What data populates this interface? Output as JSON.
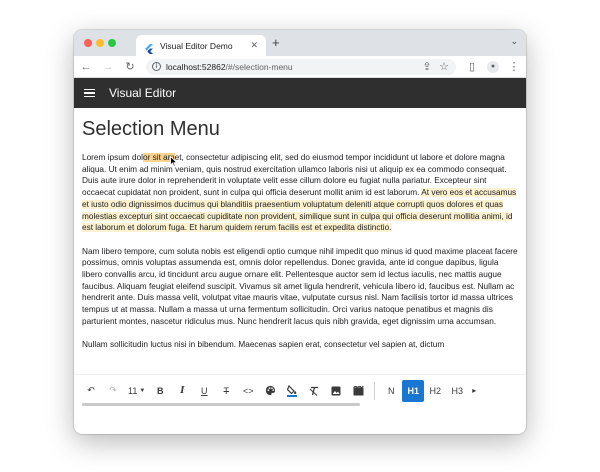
{
  "browser": {
    "tab_title": "Visual Editor Demo",
    "tab_close": "✕",
    "new_tab": "+",
    "tab_menu": "⌄",
    "url_host": "localhost:52862",
    "url_path": "/#/selection-menu",
    "icons": [
      "back-icon",
      "forward-icon",
      "reload-icon",
      "site-info-icon",
      "share-icon",
      "bookmark-star-icon",
      "side-panel-icon",
      "profile-icon",
      "kebab-menu-icon"
    ]
  },
  "app": {
    "title": "Visual Editor",
    "bar_color": "#2f2f2f"
  },
  "page": {
    "title": "Selection Menu",
    "p1": {
      "before_sel": "Lorem ipsum dol",
      "selected": "or sit am",
      "after_sel": "et, consectetur adipiscing elit, sed do eiusmod tempor incididunt ut labore et dolore magna aliqua. Ut enim ad minim veniam, quis nostrud exercitation ullamco laboris nisi ut aliquip ex ea commodo consequat. Duis aute irure dolor in reprehenderit in voluptate velit esse cillum dolore eu fugiat nulla pariatur. Excepteur sint occaecat cupidatat non proident, sunt in culpa qui officia deserunt mollit anim id est laborum.",
      "highlighted": "At vero eos et accusamus et iusto odio dignissimos ducimus qui blanditiis praesentium voluptatum deleniti atque corrupti quos dolores et quas molestias excepturi sint occaecati cupiditate non provident, similique sunt in culpa qui officia deserunt mollitia animi, id est laborum et dolorum fuga. Et harum quidem rerum facilis est et expedita distinctio."
    },
    "p2": "Nam libero tempore, cum soluta nobis est eligendi optio cumque nihil impedit quo minus id quod maxime placeat facere possimus, omnis voluptas assumenda est, omnis dolor repellendus. Donec gravida, ante id congue dapibus, ligula libero convallis arcu, id tincidunt arcu augue ornare elit. Pellentesque auctor sem id lectus iaculis, nec mattis augue faucibus. Aliquam feugiat eleifend suscipit. Vivamus sit amet ligula hendrerit, vehicula libero id, faucibus est. Nullam ac hendrerit ante. Duis massa velit, volutpat vitae mauris vitae, vulputate cursus nisl. Nam facilisis tortor id massa ultrices tempus ut at massa. Nullam a massa ut urna fermentum sollicitudin. Orci varius natoque penatibus et magnis dis parturient montes, nascetur ridiculus mus. Nunc hendrerit lacus quis nibh gravida, eget dignissim urna accumsan.",
    "p3": "Nullam sollicitudin luctus nisi in bibendum. Maecenas sapien erat, consectetur vel sapien at, dictum"
  },
  "toolbar": {
    "undo": "↶",
    "redo": "↷",
    "font_size": "11",
    "font_size_caret": "▼",
    "bold": "B",
    "italic": "I",
    "underline": "U",
    "strike": "T",
    "code": "<>",
    "heading_normal": "N",
    "heading_h1": "H1",
    "heading_h2": "H2",
    "heading_h3": "H3",
    "more": "▸",
    "active_color": "#1976d2",
    "selected_highlight_color": "#fbd38d",
    "text_highlight_color": "#fdf2cf"
  }
}
